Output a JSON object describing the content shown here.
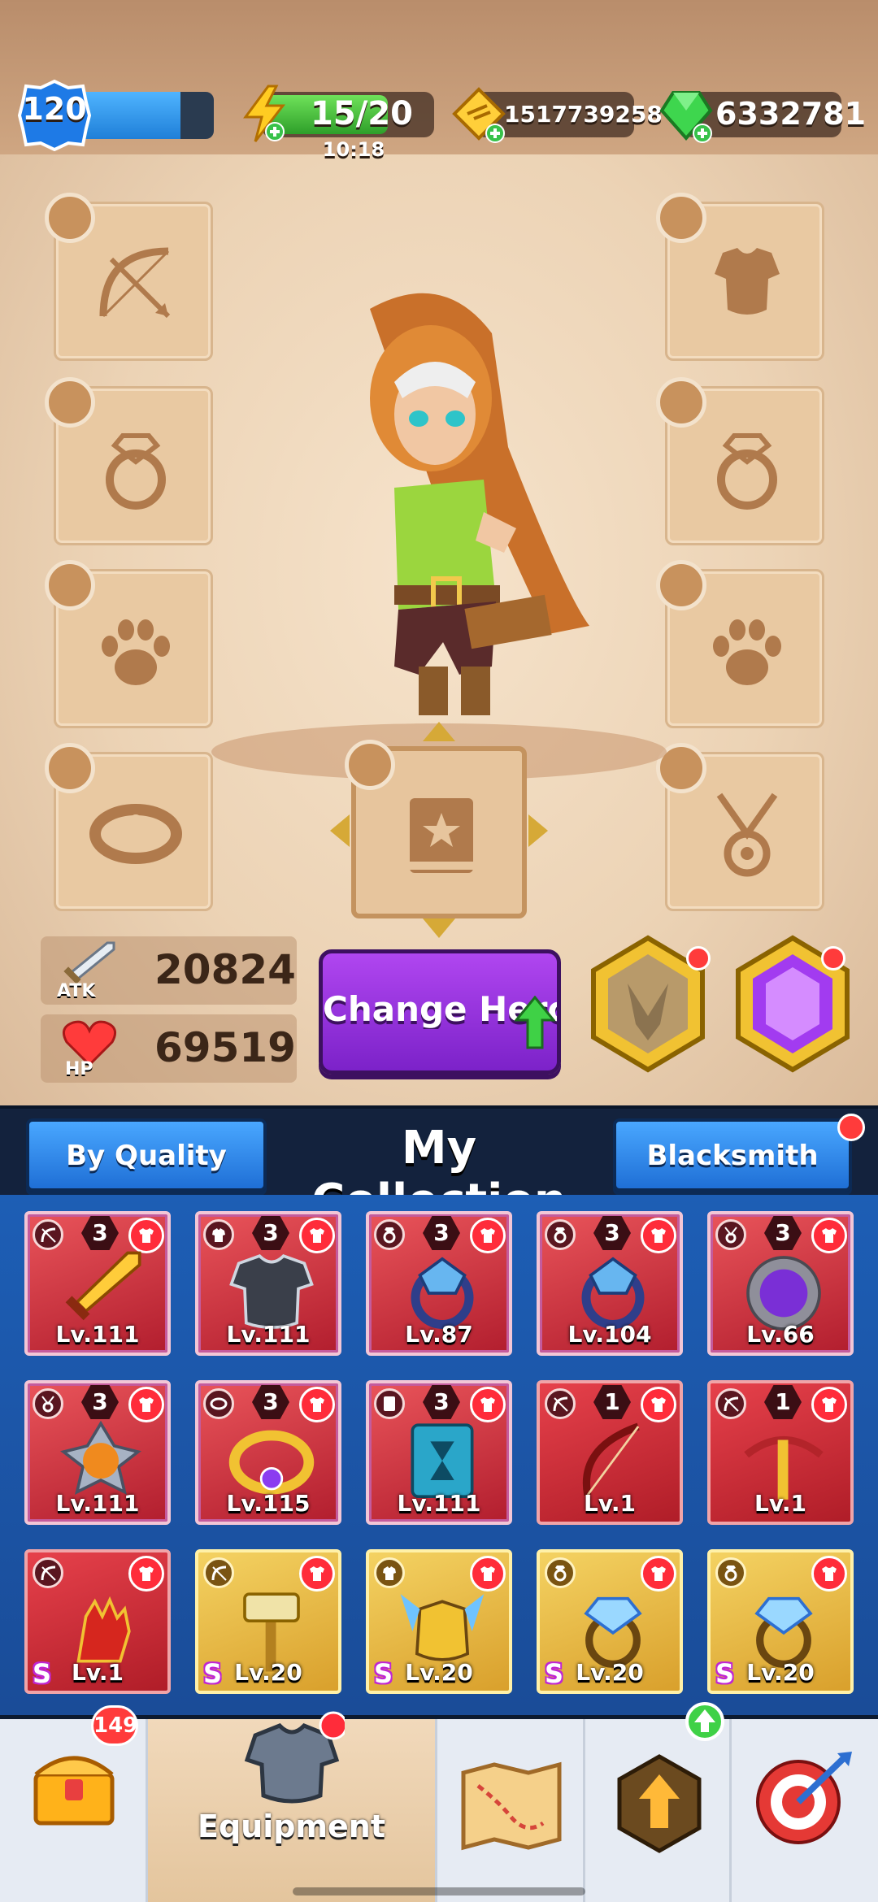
{
  "resources": {
    "level": "120",
    "level_progress": 0.8,
    "energy": "15/20",
    "energy_progress": 0.75,
    "energy_timer": "10:18",
    "gold": "1517739258",
    "gems": "6332781"
  },
  "slots": {
    "weapon": "bow-icon",
    "armor": "armor-icon",
    "ring_left": "ring-icon",
    "ring_right": "ring-icon",
    "pet_left": "paw-icon",
    "pet_right": "paw-icon",
    "bracelet": "bracelet-icon",
    "book": "spellbook-icon",
    "locket": "necklace-icon"
  },
  "stats": {
    "atk_label": "ATK",
    "atk_value": "20824",
    "hp_label": "HP",
    "hp_value": "69519"
  },
  "change_hero_label": "Change Hero",
  "collection": {
    "sort_label": "By Quality",
    "title": "My Collection",
    "blacksmith_label": "Blacksmith",
    "items": [
      {
        "count": "3",
        "level": "Lv.111",
        "grade": "",
        "art": "sword"
      },
      {
        "count": "3",
        "level": "Lv.111",
        "grade": "",
        "art": "armor"
      },
      {
        "count": "3",
        "level": "Lv.87",
        "grade": "",
        "art": "dragon-ring"
      },
      {
        "count": "3",
        "level": "Lv.104",
        "grade": "",
        "art": "dragon-ring"
      },
      {
        "count": "3",
        "level": "Lv.66",
        "grade": "",
        "art": "medallion"
      },
      {
        "count": "3",
        "level": "Lv.111",
        "grade": "",
        "art": "amulet"
      },
      {
        "count": "3",
        "level": "Lv.115",
        "grade": "",
        "art": "bracelet"
      },
      {
        "count": "3",
        "level": "Lv.111",
        "grade": "",
        "art": "hourglass-book"
      },
      {
        "count": "1",
        "level": "Lv.1",
        "grade": "",
        "art": "bow"
      },
      {
        "count": "1",
        "level": "Lv.1",
        "grade": "",
        "art": "crossbow"
      },
      {
        "count": "",
        "level": "Lv.1",
        "grade": "S",
        "art": "gauntlet"
      },
      {
        "count": "",
        "level": "Lv.20",
        "grade": "S",
        "art": "hammer"
      },
      {
        "count": "",
        "level": "Lv.20",
        "grade": "S",
        "art": "winged-armor"
      },
      {
        "count": "",
        "level": "Lv.20",
        "grade": "S",
        "art": "gem-ring"
      },
      {
        "count": "",
        "level": "Lv.20",
        "grade": "S",
        "art": "gem-ring"
      }
    ]
  },
  "nav": {
    "shop_badge": "149",
    "equipment_label": "Equipment",
    "icons": [
      "treasure-chest-icon",
      "armor-icon",
      "map-icon",
      "upgrade-arrow-icon",
      "target-icon"
    ]
  },
  "colors": {
    "purple_button": "#8b2fd8",
    "blue_button": "#2f8cf0",
    "badge_red": "#ff3b3b"
  }
}
